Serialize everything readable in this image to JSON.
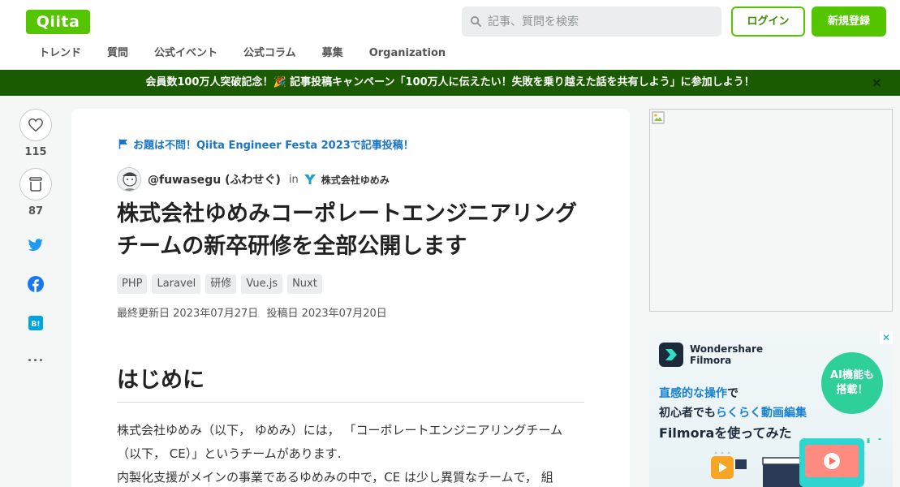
{
  "header": {
    "logo": "Qiita",
    "search_placeholder": "記事、質問を検索",
    "login": "ログイン",
    "signup": "新規登録",
    "nav": [
      "トレンド",
      "質問",
      "公式イベント",
      "公式コラム",
      "募集",
      "Organization"
    ]
  },
  "banner": {
    "text": "会員数100万人突破記念！🎉 記事投稿キャンペーン「100万人に伝えたい！失敗を乗り越えた話を共有しよう」に参加しよう！",
    "close": "×"
  },
  "side": {
    "likes": "115",
    "stocks": "87",
    "more": "•••"
  },
  "article": {
    "event": "お題は不問！Qiita Engineer Festa 2023で記事投稿！",
    "author": "@fuwasegu (ふわせぐ)",
    "in": "in",
    "org": "株式会社ゆめみ",
    "title": "株式会社ゆめみコーポレートエンジニアリングチームの新卒研修を全部公開します",
    "tags": [
      "PHP",
      "Laravel",
      "研修",
      "Vue.js",
      "Nuxt"
    ],
    "updated": "最終更新日 2023年07月27日",
    "posted": "投稿日 2023年07月20日",
    "heading": "はじめに",
    "paragraph": "株式会社ゆめみ（以下， ゆめみ）には， 「コーポレートエンジニアリングチーム（以下， CE）」というチームがあります.\n内製化支援がメインの事業であるゆめみの中で，CE は少し異質なチームで， 組"
  },
  "ad": {
    "brand": "Wondershare Filmora",
    "badge_line1": "AI機能も",
    "badge_line2": "搭載！",
    "line1_highlight": "直感的な操作",
    "line1_rest": "で",
    "line2_pre": "初心者でも",
    "line2_highlight": "らくらく動画編集",
    "line3": "Filmoraを使ってみた",
    "close": "✕"
  },
  "colors": {
    "brand": "#55c500",
    "banner": "#1a5a00",
    "link": "#1a74c4"
  }
}
